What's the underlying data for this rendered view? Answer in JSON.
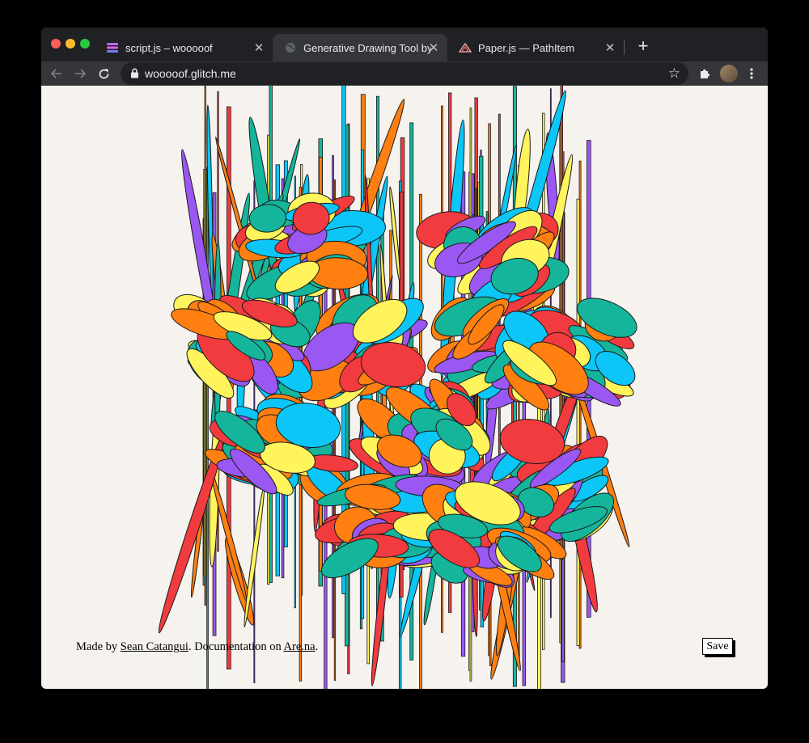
{
  "browser": {
    "tabs": [
      {
        "title": "script.js – wooooof",
        "active": false,
        "icon": "glitch-icon"
      },
      {
        "title": "Generative Drawing Tool by Sean Catangui",
        "active": true,
        "icon": "globe-icon"
      },
      {
        "title": "Paper.js — PathItem",
        "active": false,
        "icon": "paperjs-icon"
      }
    ],
    "url": "wooooof.glitch.me",
    "new_tab_label": "+"
  },
  "page": {
    "footer": {
      "prefix": "Made by ",
      "author": "Sean Catangui",
      "middle": ". Documentation on ",
      "docs": "Are.na",
      "suffix": "."
    },
    "save_label": "Save"
  },
  "artwork": {
    "palette": [
      "#f23b3f",
      "#ff7f11",
      "#fff45c",
      "#15b59b",
      "#0bc6f7",
      "#9b57f2"
    ],
    "stroke": "#1a1a1a",
    "background": "#f6f3ef"
  }
}
